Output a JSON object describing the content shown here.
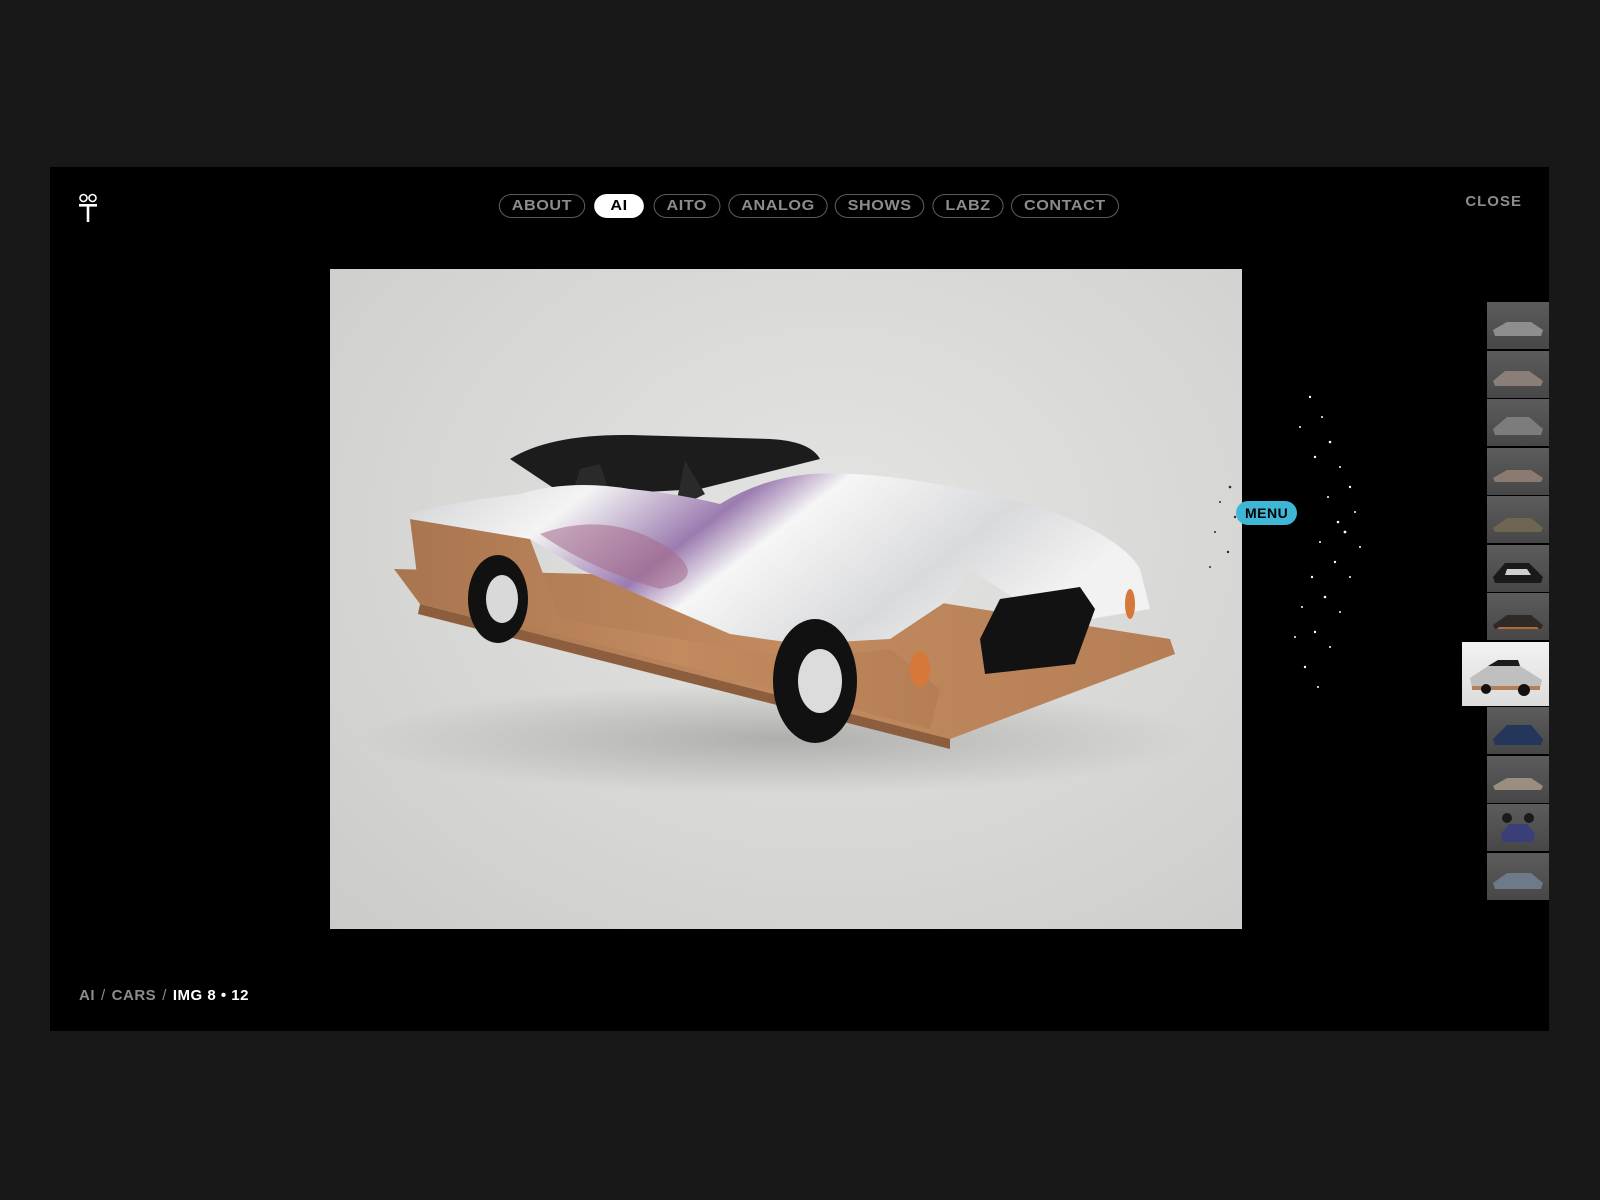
{
  "nav": {
    "items": [
      {
        "label": "ABOUT",
        "active": false
      },
      {
        "label": "AI",
        "active": true
      },
      {
        "label": "AITO",
        "active": false
      },
      {
        "label": "ANALOG",
        "active": false
      },
      {
        "label": "SHOWS",
        "active": false
      },
      {
        "label": "LABZ",
        "active": false
      },
      {
        "label": "CONTACT",
        "active": false
      }
    ]
  },
  "close_label": "CLOSE",
  "menu_label": "MENU",
  "breadcrumb": {
    "section": "AI",
    "sep1": "/",
    "album": "CARS",
    "sep2": "/",
    "current": "IMG 8 • 12"
  },
  "thumbnails": {
    "count": 12,
    "active_index": 7
  },
  "colors": {
    "frame_bg": "#000000",
    "page_bg": "#181818",
    "accent": "#3fb6d6",
    "muted_text": "#8c8c8c"
  }
}
